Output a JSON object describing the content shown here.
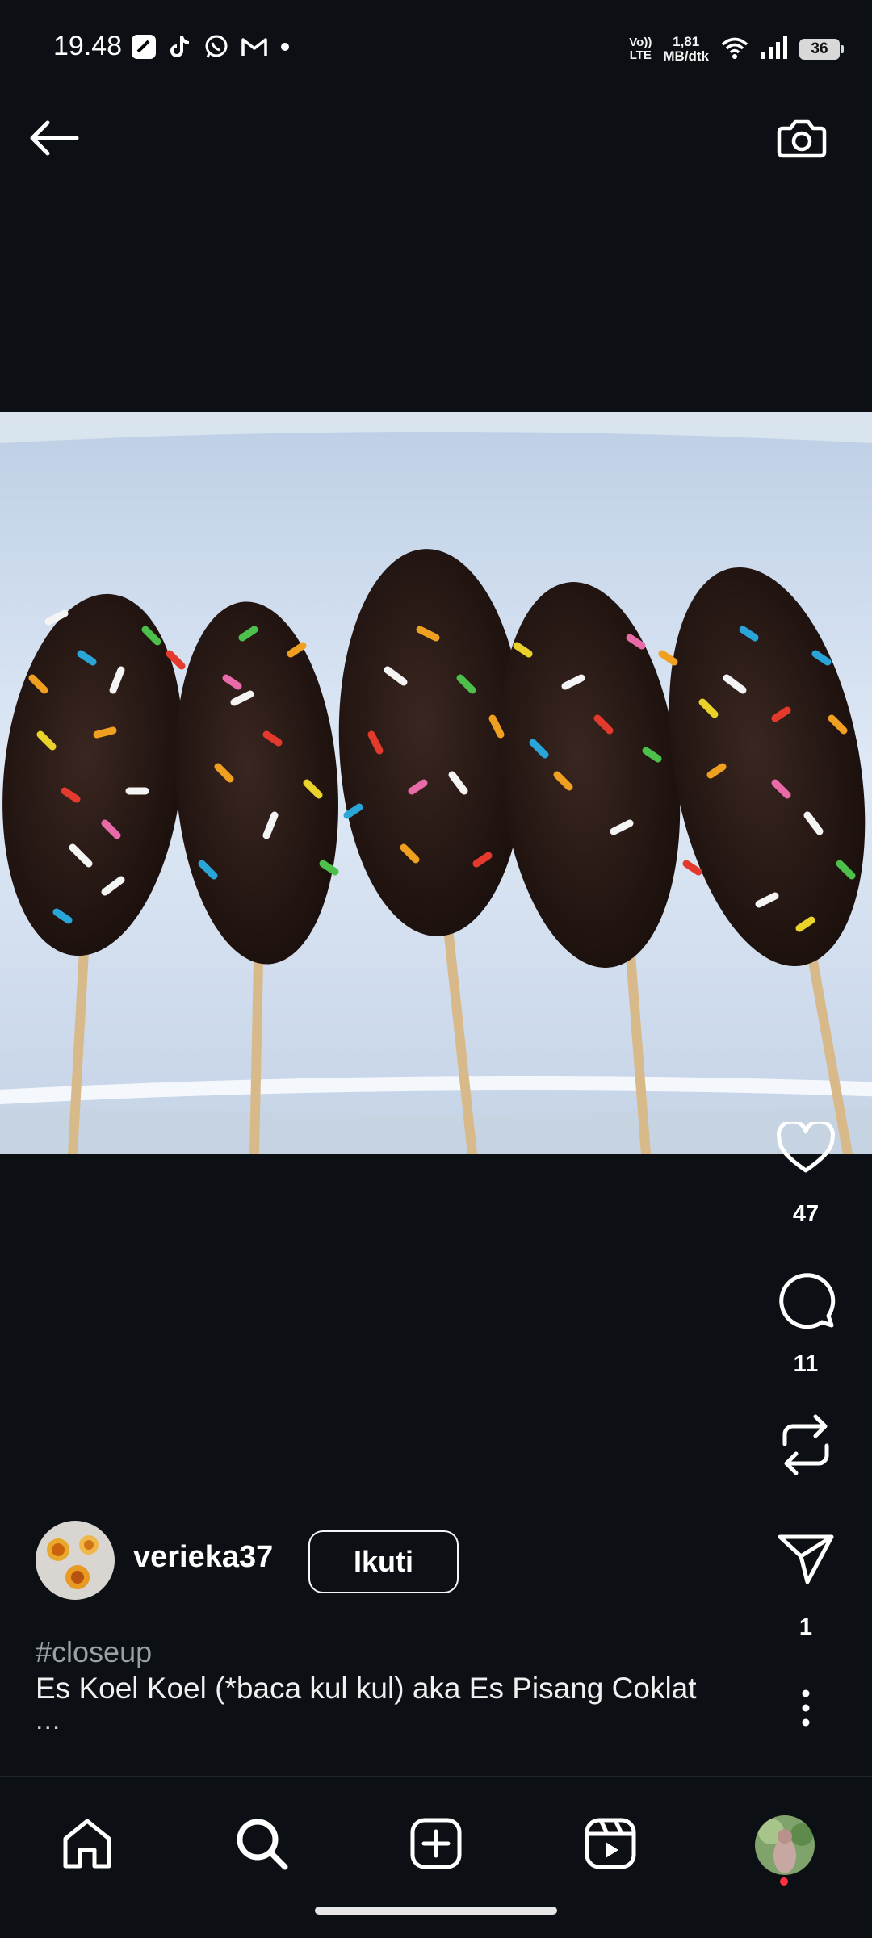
{
  "status_bar": {
    "time": "19.48",
    "network_type": "Vo)) LTE",
    "speed_value": "1,81",
    "speed_unit": "MB/dtk",
    "battery": "36"
  },
  "post": {
    "likes": "47",
    "comments": "11",
    "shares": "1",
    "username": "verieka37",
    "follow_label": "Ikuti",
    "hashtag": "#closeup",
    "caption": "Es Koel Koel (*baca kul kul) aka Es Pisang Coklat",
    "more": "..."
  },
  "icons": {
    "back": "arrow-left-icon",
    "camera": "camera-icon",
    "like": "heart-icon",
    "comment": "comment-icon",
    "repost": "repost-icon",
    "share": "send-icon",
    "options": "more-vertical-icon",
    "nav": [
      "home-icon",
      "search-icon",
      "create-icon",
      "reels-icon",
      "profile-avatar"
    ]
  },
  "colors": {
    "background": "#0c1014",
    "foreground": "#f5f5f5",
    "notification_dot": "#ff3040"
  }
}
